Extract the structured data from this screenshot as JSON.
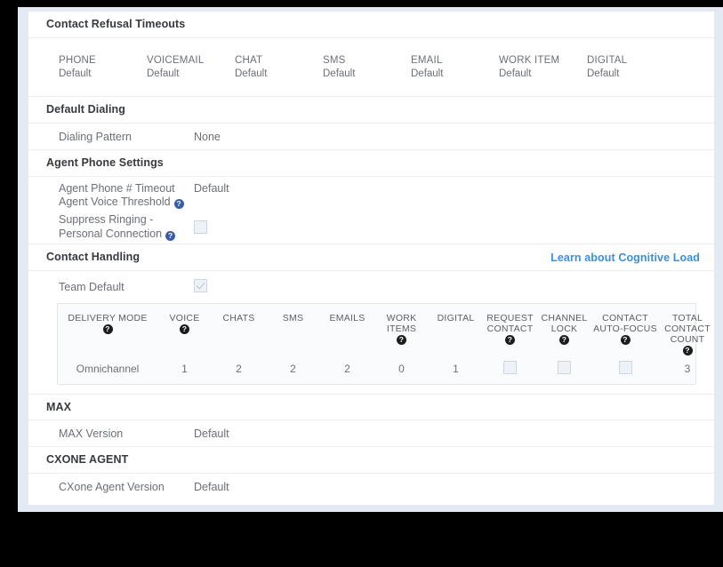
{
  "refusal": {
    "title": "Contact Refusal Timeouts",
    "items": [
      {
        "name": "PHONE",
        "value": "Default"
      },
      {
        "name": "VOICEMAIL",
        "value": "Default"
      },
      {
        "name": "CHAT",
        "value": "Default"
      },
      {
        "name": "SMS",
        "value": "Default"
      },
      {
        "name": "EMAIL",
        "value": "Default"
      },
      {
        "name": "WORK ITEM",
        "value": "Default"
      },
      {
        "name": "DIGITAL",
        "value": "Default"
      }
    ]
  },
  "default_dialing": {
    "title": "Default Dialing",
    "rows": [
      {
        "label": "Dialing Pattern",
        "value": "None"
      }
    ]
  },
  "agent_phone": {
    "title": "Agent Phone Settings",
    "rows": [
      {
        "label": "Agent Phone # Timeout",
        "value": "Default"
      },
      {
        "label": "Agent Voice Threshold",
        "value": ""
      },
      {
        "label_line1": "Suppress Ringing -",
        "label_line2": "Personal Connection"
      }
    ]
  },
  "contact_handling": {
    "title": "Contact Handling",
    "link": "Learn about Cognitive Load",
    "team_default_label": "Team Default",
    "team_default_checked": true,
    "table": {
      "columns": [
        {
          "key": "mode",
          "label": "DELIVERY MODE",
          "help": true
        },
        {
          "key": "voice",
          "label": "VOICE",
          "help": true
        },
        {
          "key": "chats",
          "label": "CHATS",
          "help": false
        },
        {
          "key": "sms",
          "label": "SMS",
          "help": false
        },
        {
          "key": "emails",
          "label": "EMAILS",
          "help": false
        },
        {
          "key": "work",
          "label_line1": "WORK",
          "label_line2": "ITEMS",
          "help": true
        },
        {
          "key": "digital",
          "label": "DIGITAL",
          "help": false
        },
        {
          "key": "req",
          "label_line1": "REQUEST",
          "label_line2": "CONTACT",
          "help": true
        },
        {
          "key": "lock",
          "label_line1": "CHANNEL",
          "label_line2": "LOCK",
          "help": true
        },
        {
          "key": "focus",
          "label_line1": "CONTACT",
          "label_line2": "AUTO-FOCUS",
          "help": true
        },
        {
          "key": "total",
          "label_line1": "TOTAL",
          "label_line2": "CONTACT",
          "label_line3": "COUNT",
          "help": true
        }
      ],
      "row": {
        "mode": "Omnichannel",
        "voice": "1",
        "chats": "2",
        "sms": "2",
        "emails": "2",
        "work": "0",
        "digital": "1",
        "req_checked": false,
        "lock_checked": false,
        "focus_checked": false,
        "total": "3"
      }
    }
  },
  "max": {
    "title": "MAX",
    "rows": [
      {
        "label": "MAX Version",
        "value": "Default"
      }
    ]
  },
  "cxone_agent": {
    "title": "CXONE AGENT",
    "rows": [
      {
        "label": "CXone Agent Version",
        "value": "Default"
      }
    ]
  },
  "icons": {
    "help": "?",
    "help_icon_name": "help-circle-icon"
  },
  "colors": {
    "link_blue": "#3d8fd6",
    "help_blue": "#3b5ca8",
    "help_dark": "#1c1c1c",
    "text_gray": "#6b7076",
    "heading": "#36393d"
  }
}
